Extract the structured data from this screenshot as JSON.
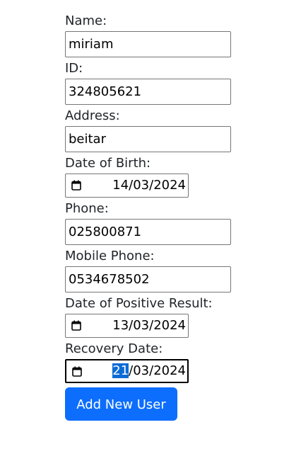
{
  "form": {
    "name": {
      "label": "Name:",
      "value": "miriam"
    },
    "id": {
      "label": "ID:",
      "value": "324805621"
    },
    "address": {
      "label": "Address:",
      "value": "beitar"
    },
    "date_of_birth": {
      "label": "Date of Birth:",
      "value": "14/03/2024"
    },
    "phone": {
      "label": "Phone:",
      "value": "025800871"
    },
    "mobile_phone": {
      "label": "Mobile Phone:",
      "value": "0534678502"
    },
    "date_of_positive_result": {
      "label": "Date of Positive Result:",
      "value": "13/03/2024"
    },
    "recovery_date": {
      "label": "Recovery Date:",
      "day": "21",
      "rest": "/03/2024"
    },
    "submit_label": "Add New User"
  },
  "colors": {
    "button": "#0d6efd",
    "selection": "#0b6bd6"
  },
  "icons": {
    "date_picker": "calendar-icon"
  }
}
